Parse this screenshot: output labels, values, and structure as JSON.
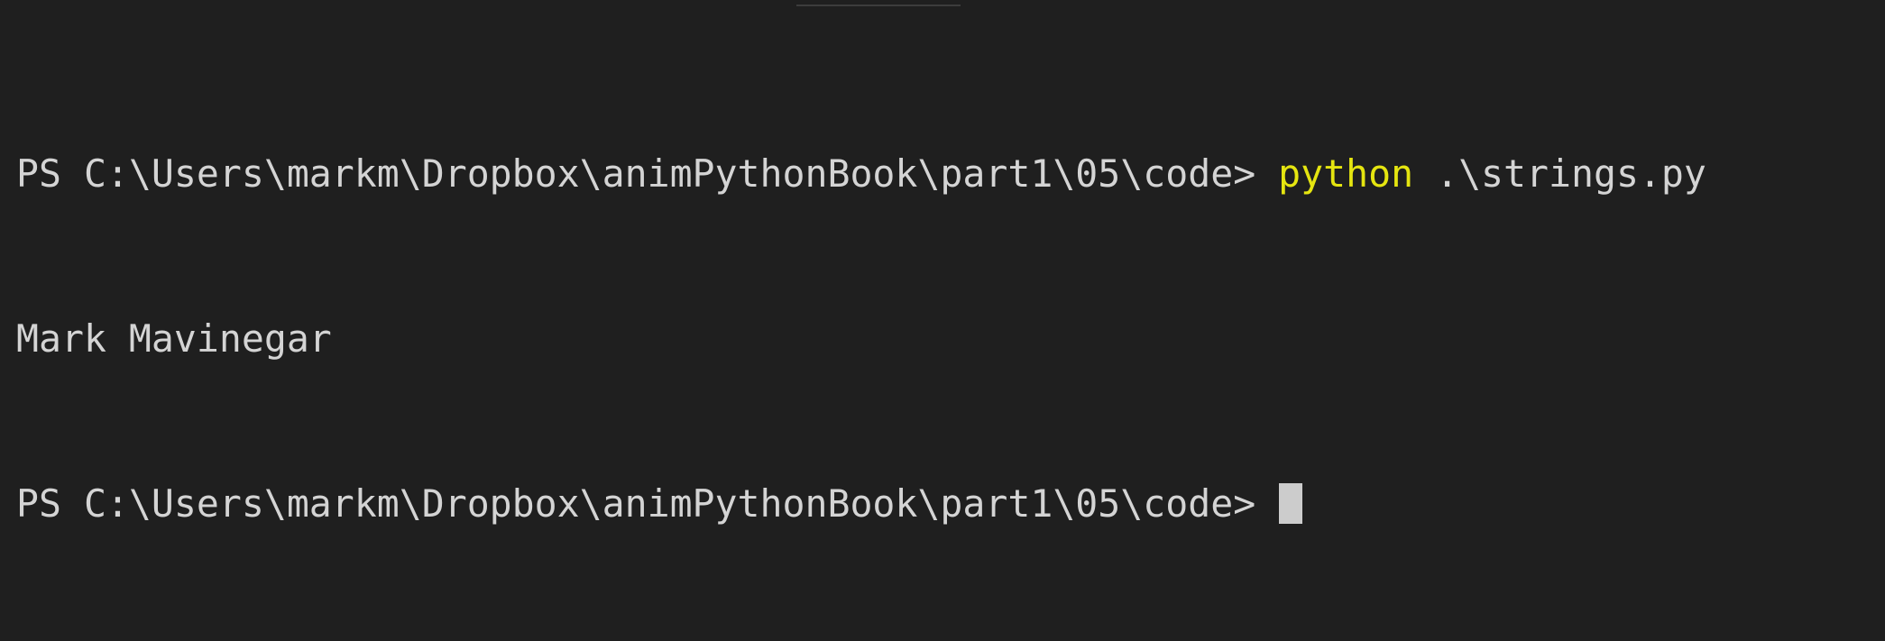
{
  "terminal": {
    "line1": {
      "prompt": "PS C:\\Users\\markm\\Dropbox\\animPythonBook\\part1\\05\\code> ",
      "command": "python",
      "args": " .\\strings.py"
    },
    "output": "Mark Mavinegar",
    "line3": {
      "prompt": "PS C:\\Users\\markm\\Dropbox\\animPythonBook\\part1\\05\\code>"
    }
  },
  "colors": {
    "background": "#1f1f1f",
    "text": "#d4d4d4",
    "command": "#e5e510",
    "cursor": "#cccccc"
  }
}
